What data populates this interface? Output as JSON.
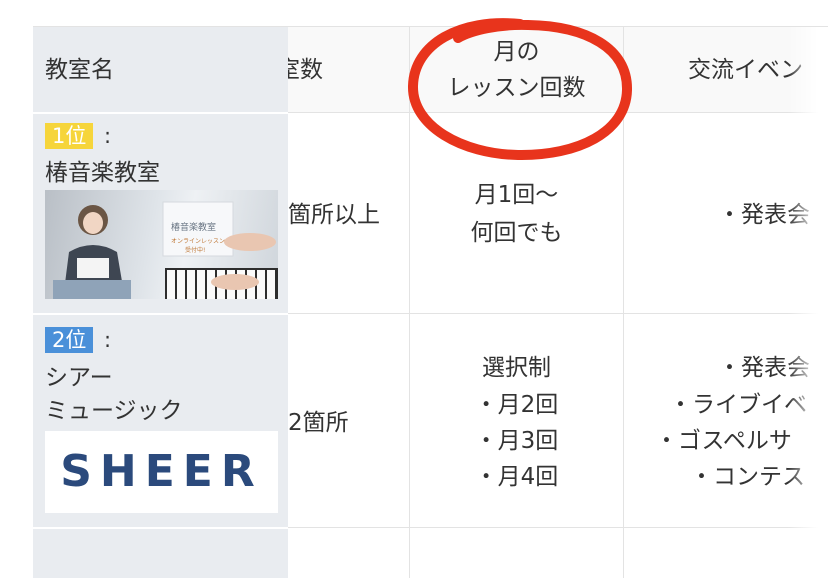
{
  "table": {
    "headers": {
      "name": "教室名",
      "rooms": "教室数",
      "lessons_line1": "月の",
      "lessons_line2": "レッスン回数",
      "events": "交流イベン"
    },
    "rows": [
      {
        "rank_label": "1位",
        "rank_color": "#f6d53b",
        "name_lines": [
          "椿音楽教室"
        ],
        "thumb_text": [
          "椿音楽教室",
          "オンラインレッスン",
          "受付中!"
        ],
        "rooms": "箇所以上",
        "lessons": [
          "月1回〜",
          "何回でも"
        ],
        "events": [
          "・発表会"
        ]
      },
      {
        "rank_label": "2位",
        "rank_color": "#4a90d9",
        "name_lines": [
          "シアー",
          "ミュージック"
        ],
        "logo_text": "SHEER",
        "rooms": "2箇所",
        "lessons": [
          "選択制",
          "・月2回",
          "・月3回",
          "・月4回"
        ],
        "events": [
          "・発表会",
          "・ライブイベ",
          "・ゴスペルサ",
          "・コンテス"
        ]
      }
    ]
  },
  "colors": {
    "sticky_bg": "#e9ecf0",
    "grid": "#e3e3e3",
    "annotation_circle": "#e8341c",
    "logo": "#2b4a7c"
  }
}
